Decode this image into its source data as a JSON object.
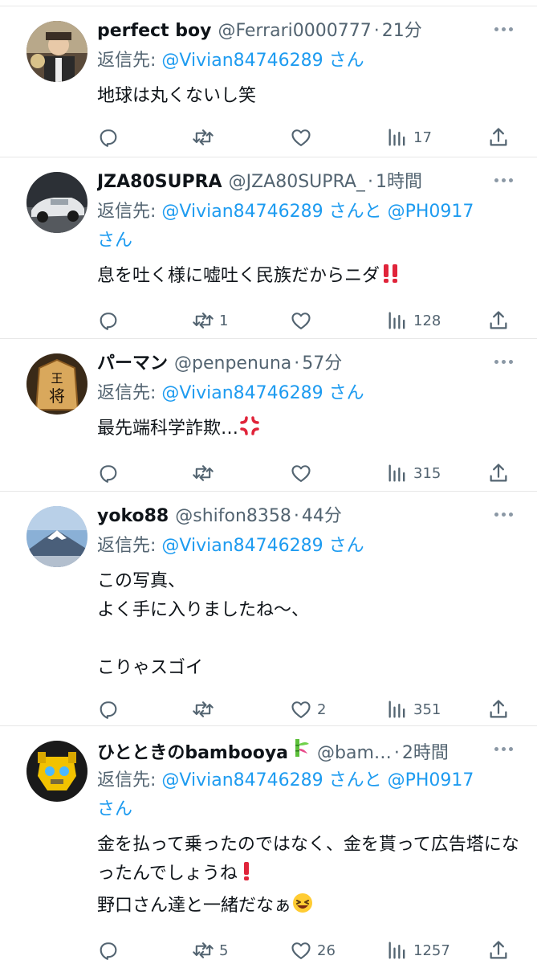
{
  "tweets": [
    {
      "name": "perfect boy",
      "handle": "@Ferrari0000777",
      "time": "21分",
      "reply_prefix": "返信先: ",
      "reply_mentions": "@Vivian84746289 さん",
      "reply_and": "",
      "reply_mention2": "",
      "reply_suffix": "",
      "text": "地球は丸くないし笑",
      "counts": {
        "reply": "",
        "retweet": "",
        "like": "",
        "views": "17"
      }
    },
    {
      "name": "JZA80SUPRA",
      "handle": "@JZA80SUPRA_",
      "time": "1時間",
      "reply_prefix": "返信先: ",
      "reply_mentions": "@Vivian84746289 さん",
      "reply_and": "と ",
      "reply_mention2": "@PH0917",
      "reply_suffix": "さん",
      "text": "息を吐く様に嘘吐く民族だからニダ",
      "counts": {
        "reply": "",
        "retweet": "1",
        "like": "",
        "views": "128"
      }
    },
    {
      "name": "パーマン",
      "handle": "@penpenuna",
      "time": "57分",
      "reply_prefix": "返信先: ",
      "reply_mentions": "@Vivian84746289 さん",
      "reply_and": "",
      "reply_mention2": "",
      "reply_suffix": "",
      "text": "最先端科学詐欺…",
      "counts": {
        "reply": "",
        "retweet": "",
        "like": "",
        "views": "315"
      }
    },
    {
      "name": "yoko88",
      "handle": "@shifon8358",
      "time": "44分",
      "reply_prefix": "返信先: ",
      "reply_mentions": "@Vivian84746289 さん",
      "reply_and": "",
      "reply_mention2": "",
      "reply_suffix": "",
      "text": "この写真、\nよく手に入りましたね〜、\n\nこりゃスゴイ",
      "counts": {
        "reply": "",
        "retweet": "",
        "like": "2",
        "views": "351"
      }
    },
    {
      "name": "ひとときのbambooya",
      "handle": "@bam…",
      "time": "2時間",
      "reply_prefix": "返信先: ",
      "reply_mentions": "@Vivian84746289 さん",
      "reply_and": "と ",
      "reply_mention2": "@PH0917",
      "reply_suffix": "さん",
      "text": "金を払って乗ったのではなく、金を貰って広告塔になったんでしょうね",
      "text2": "野口さん達と一緒だなぁ",
      "counts": {
        "reply": "",
        "retweet": "5",
        "like": "26",
        "views": "1257"
      }
    }
  ],
  "colors": {
    "accent": "#1d9bf0",
    "secondary": "#536471",
    "text": "#0f1419",
    "divider": "#e7e7e7"
  },
  "icons": [
    "reply-icon",
    "retweet-icon",
    "like-icon",
    "views-icon",
    "share-icon",
    "more-icon"
  ]
}
